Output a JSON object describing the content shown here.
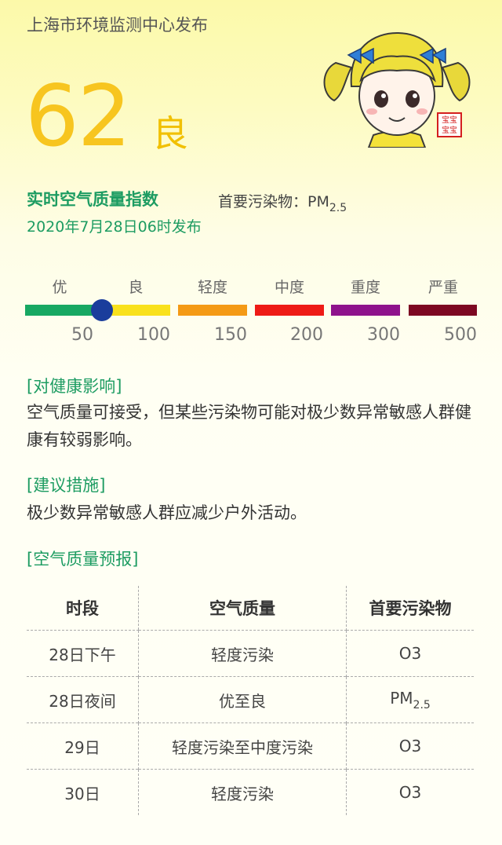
{
  "header": {
    "publisher": "上海市环境监测中心发布"
  },
  "aqi": {
    "value": "62",
    "level": "良"
  },
  "realtime": {
    "label": "实时空气质量指数",
    "pollutant_prefix": "首要污染物：",
    "pollutant_main": "PM",
    "pollutant_sub": "2.5",
    "timestamp": "2020年7月28日06时发布"
  },
  "scale": {
    "levels": [
      "优",
      "良",
      "轻度",
      "中度",
      "重度",
      "严重"
    ],
    "thresholds": [
      "50",
      "100",
      "150",
      "200",
      "300",
      "500"
    ],
    "colors": [
      "#17a862",
      "#f9e11c",
      "#f49a15",
      "#ee1b16",
      "#8e128c",
      "#7d0822"
    ],
    "indicator_value": 62
  },
  "health": {
    "heading": "[对健康影响]",
    "text": "空气质量可接受，但某些污染物可能对极少数异常敏感人群健康有较弱影响。"
  },
  "advice": {
    "heading": "[建议措施]",
    "text": "极少数异常敏感人群应减少户外活动。"
  },
  "forecast": {
    "heading": "[空气质量预报]",
    "columns": [
      "时段",
      "空气质量",
      "首要污染物"
    ],
    "rows": [
      {
        "period": "28日下午",
        "quality": "轻度污染",
        "pollutant": "O3",
        "pollutant_sub": ""
      },
      {
        "period": "28日夜间",
        "quality": "优至良",
        "pollutant": "PM",
        "pollutant_sub": "2.5"
      },
      {
        "period": "29日",
        "quality": "轻度污染至中度污染",
        "pollutant": "O3",
        "pollutant_sub": ""
      },
      {
        "period": "30日",
        "quality": "轻度污染",
        "pollutant": "O3",
        "pollutant_sub": ""
      }
    ]
  },
  "mascot": {
    "icon": "girl-mascot-icon",
    "seal_text": "宝宝宝宝"
  }
}
